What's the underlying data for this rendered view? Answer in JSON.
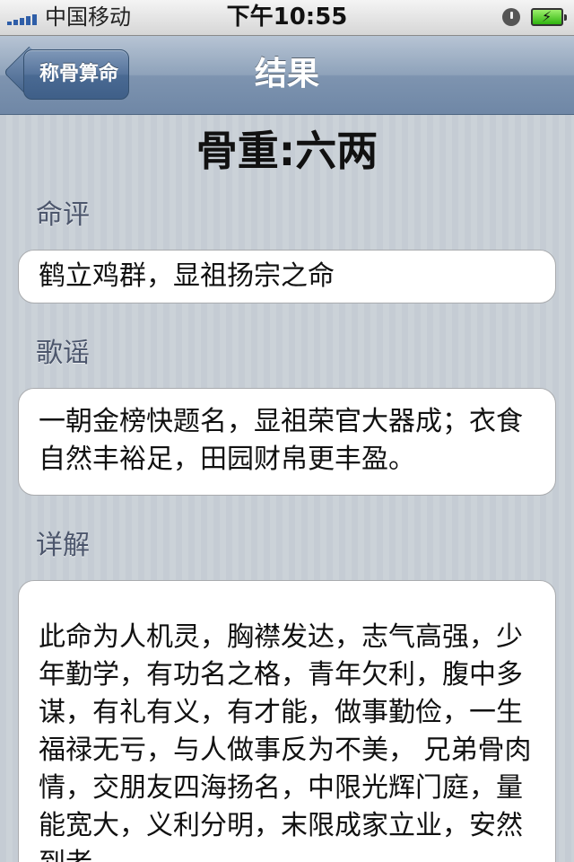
{
  "status_bar": {
    "carrier": "中国移动",
    "time": "下午10:55",
    "icons": [
      "signal-icon",
      "lock-icon",
      "battery-charging-icon"
    ]
  },
  "nav": {
    "back_label": "称骨算命",
    "title": "结果"
  },
  "headline": "骨重:六两",
  "sections": [
    {
      "label": "命评",
      "text": "鹤立鸡群，显祖扬宗之命"
    },
    {
      "label": "歌谣",
      "text": "一朝金榜快题名，显祖荣官大器成；衣食自然丰裕足，田园财帛更丰盈。"
    },
    {
      "label": "详解",
      "text": "此命为人机灵，胸襟发达，志气高强，少年勤学，有功名之格，青年欠利，腹中多谋，有礼有义，有才能，做事勤俭，一生福禄无亏，与人做事反为不美， 兄弟骨肉情，交朋友四海扬名，中限光辉门庭，量能宽大，义利分明，末限成家立业，安然到老"
    }
  ],
  "colors": {
    "nav_bar": "#8ea2ba",
    "background": "#c5ccd4",
    "section_label": "#4c566c",
    "card": "#ffffff"
  }
}
